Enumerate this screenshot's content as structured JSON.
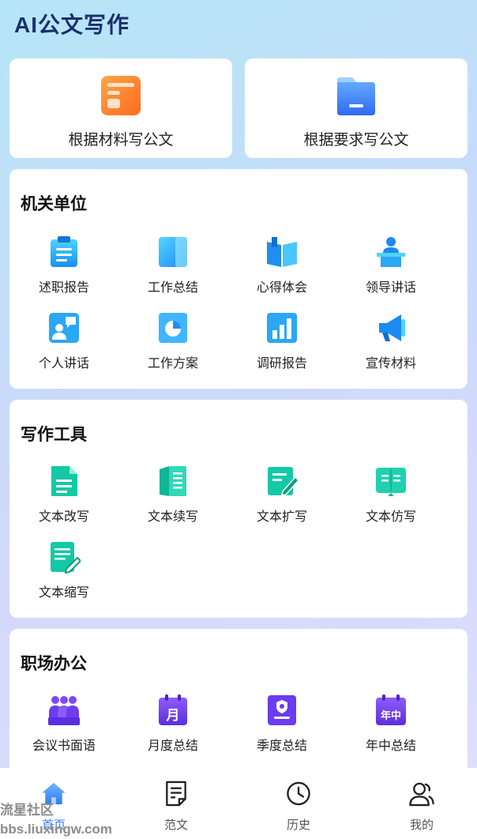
{
  "app_title": "AI公文写作",
  "top_cards": [
    {
      "label": "根据材料写公文",
      "icon": "document-orange-icon"
    },
    {
      "label": "根据要求写公文",
      "icon": "folder-blue-icon"
    }
  ],
  "sections": [
    {
      "title": "机关单位",
      "items": [
        {
          "label": "述职报告",
          "icon": "clipboard-icon"
        },
        {
          "label": "工作总结",
          "icon": "notebook-icon"
        },
        {
          "label": "心得体会",
          "icon": "open-book-icon"
        },
        {
          "label": "领导讲话",
          "icon": "podium-speaker-icon"
        },
        {
          "label": "个人讲话",
          "icon": "speech-person-icon"
        },
        {
          "label": "工作方案",
          "icon": "pie-chart-icon"
        },
        {
          "label": "调研报告",
          "icon": "bar-chart-icon"
        },
        {
          "label": "宣传材料",
          "icon": "megaphone-icon"
        }
      ]
    },
    {
      "title": "写作工具",
      "items": [
        {
          "label": "文本改写",
          "icon": "document-lines-icon"
        },
        {
          "label": "文本续写",
          "icon": "book-pages-icon"
        },
        {
          "label": "文本扩写",
          "icon": "edit-pen-icon"
        },
        {
          "label": "文本仿写",
          "icon": "book-copy-icon"
        },
        {
          "label": "文本缩写",
          "icon": "note-pencil-icon"
        }
      ]
    },
    {
      "title": "职场办公",
      "items": [
        {
          "label": "会议书面语",
          "icon": "meeting-people-icon"
        },
        {
          "label": "月度总结",
          "icon": "calendar-month-icon",
          "glyph": "月"
        },
        {
          "label": "季度总结",
          "icon": "badge-card-icon"
        },
        {
          "label": "年中总结",
          "icon": "calendar-midyear-icon",
          "glyph": "年中"
        }
      ]
    }
  ],
  "bottom_nav": [
    {
      "label": "首页",
      "icon": "home-icon",
      "active": true
    },
    {
      "label": "范文",
      "icon": "document-icon",
      "active": false
    },
    {
      "label": "历史",
      "icon": "clock-icon",
      "active": false
    },
    {
      "label": "我的",
      "icon": "user-icon",
      "active": false
    }
  ],
  "watermark": {
    "line1": "流星社区",
    "line2": "bbs.liuxingw.com"
  },
  "colors": {
    "accent": "#2e7cf6",
    "title": "#1c2f6e",
    "teal": "#16c8a8",
    "purple": "#6b3cf0",
    "orange": "#ff7a2e"
  }
}
